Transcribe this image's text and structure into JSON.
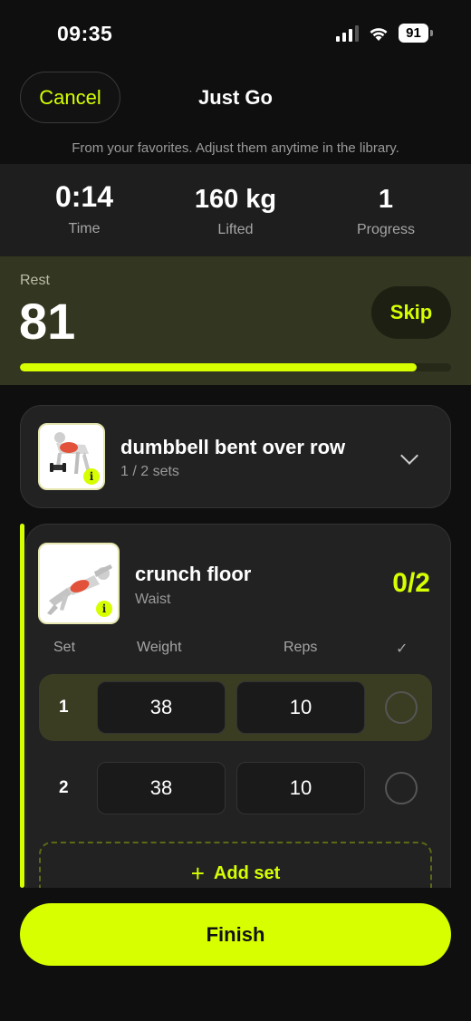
{
  "status_bar": {
    "time": "09:35",
    "battery": "91"
  },
  "header": {
    "cancel_label": "Cancel",
    "title": "Just Go"
  },
  "subtitle": "From your favorites. Adjust them anytime in the library.",
  "stats": [
    {
      "value": "0:14",
      "label": "Time"
    },
    {
      "value": "160 kg",
      "label": "Lifted"
    },
    {
      "value": "1",
      "label": "Progress"
    }
  ],
  "rest": {
    "label": "Rest",
    "value": "81",
    "skip_label": "Skip",
    "progress_fraction": 0.92
  },
  "exercises": [
    {
      "name": "dumbbell bent over row",
      "sub": "1 / 2 sets",
      "thumbnail_icon": "dumbbell-row-figure-icon",
      "info_icon": "info-icon"
    },
    {
      "name": "crunch floor",
      "sub": "Waist",
      "progress": "0/2",
      "thumbnail_icon": "crunch-figure-icon",
      "info_icon": "info-icon"
    }
  ],
  "set_table": {
    "headers": {
      "set": "Set",
      "weight": "Weight",
      "reps": "Reps",
      "done": "✓"
    },
    "rows": [
      {
        "set": "1",
        "weight": "38",
        "reps": "10",
        "current": true
      },
      {
        "set": "2",
        "weight": "38",
        "reps": "10",
        "current": false
      }
    ]
  },
  "add_set_label": "Add set",
  "finish_label": "Finish",
  "colors": {
    "accent": "#d7ff00",
    "background": "#0f0f0f",
    "card": "#222222",
    "rest_panel": "#333620"
  }
}
